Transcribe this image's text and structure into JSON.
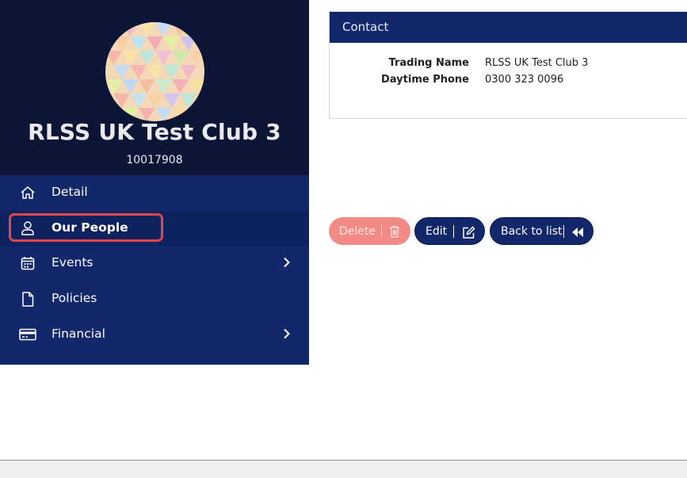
{
  "club": {
    "name": "RLSS UK Test Club 3",
    "id": "10017908"
  },
  "nav": {
    "items": [
      {
        "label": "Detail",
        "icon": "home-icon",
        "active": false,
        "has_submenu": false
      },
      {
        "label": "Our People",
        "icon": "user-icon",
        "active": true,
        "has_submenu": false
      },
      {
        "label": "Events",
        "icon": "calendar-icon",
        "active": false,
        "has_submenu": true
      },
      {
        "label": "Policies",
        "icon": "document-icon",
        "active": false,
        "has_submenu": false
      },
      {
        "label": "Financial",
        "icon": "credit-card-icon",
        "active": false,
        "has_submenu": true
      }
    ]
  },
  "contact": {
    "title": "Contact",
    "fields": [
      {
        "label": "Trading Name",
        "value": "RLSS UK Test Club 3"
      },
      {
        "label": "Daytime Phone",
        "value": "0300 323 0096"
      }
    ]
  },
  "actions": {
    "delete_label": "Delete",
    "edit_label": "Edit",
    "back_label": "Back to list"
  },
  "colors": {
    "primary": "#13286b",
    "header_dark": "#0c1535",
    "delete": "#f28b86",
    "highlight": "#e0464b"
  }
}
